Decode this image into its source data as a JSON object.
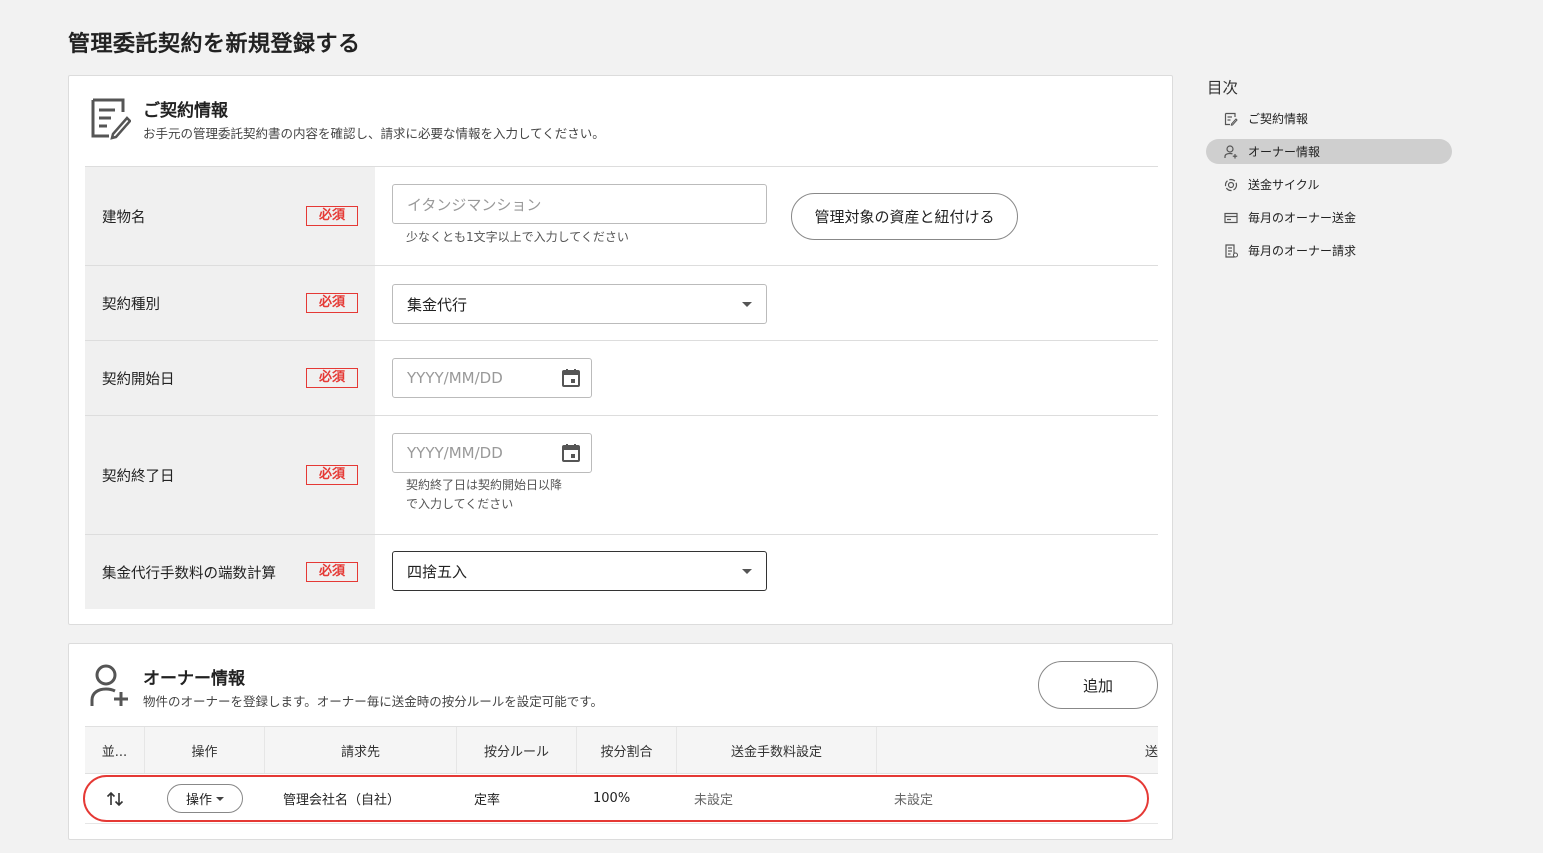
{
  "page": {
    "title": "管理委託契約を新規登録する"
  },
  "contract": {
    "title": "ご契約情報",
    "description": "お手元の管理委託契約書の内容を確認し、請求に必要な情報を入力してください。",
    "required_label": "必須",
    "fields": {
      "building": {
        "label": "建物名",
        "placeholder": "イタンジマンション",
        "helper": "少なくとも1文字以上で入力してください",
        "link_button": "管理対象の資産と紐付ける"
      },
      "contract_type": {
        "label": "契約種別",
        "value": "集金代行"
      },
      "start_date": {
        "label": "契約開始日",
        "placeholder": "YYYY/MM/DD"
      },
      "end_date": {
        "label": "契約終了日",
        "placeholder": "YYYY/MM/DD",
        "helper_line1": "契約終了日は契約開始日以降",
        "helper_line2": "で入力してください"
      },
      "rounding": {
        "label": "集金代行手数料の端数計算",
        "value": "四捨五入"
      }
    }
  },
  "owner": {
    "title": "オーナー情報",
    "description": "物件のオーナーを登録します。オーナー毎に送金時の按分ルールを設定可能です。",
    "add_button": "追加",
    "columns": [
      "並...",
      "操作",
      "請求先",
      "按分ルール",
      "按分割合",
      "送金手数料設定",
      "",
      "送"
    ],
    "rows": [
      {
        "op_label": "操作",
        "billing": "管理会社名（自社）",
        "rule": "定率",
        "ratio": "100%",
        "fee": "未設定",
        "extra": "未設定"
      }
    ]
  },
  "toc": {
    "title": "目次",
    "items": [
      {
        "label": "ご契約情報",
        "icon": "edit-doc-icon",
        "active": false
      },
      {
        "label": "オーナー情報",
        "icon": "person-add-icon",
        "active": true
      },
      {
        "label": "送金サイクル",
        "icon": "cycle-icon",
        "active": false
      },
      {
        "label": "毎月のオーナー送金",
        "icon": "card-icon",
        "active": false
      },
      {
        "label": "毎月のオーナー請求",
        "icon": "invoice-icon",
        "active": false
      }
    ]
  },
  "colors": {
    "required": "#e53935",
    "active_toc": "#cfcfcf",
    "highlight": "#e53935"
  }
}
